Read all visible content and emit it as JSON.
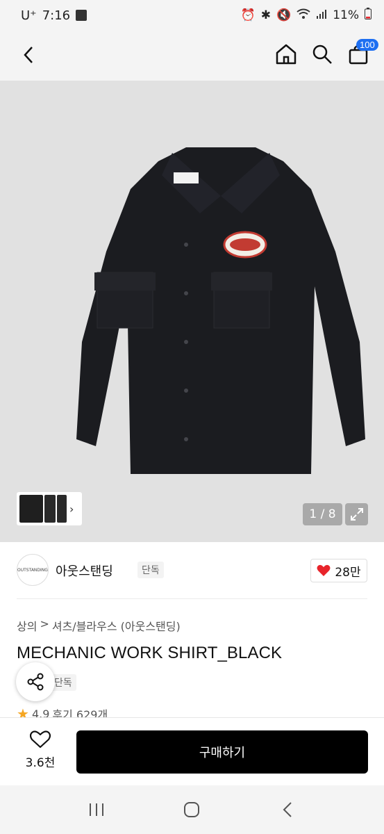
{
  "status_bar": {
    "carrier": "U⁺",
    "time": "7:16",
    "battery": "11%"
  },
  "top_nav": {
    "cart_count": "100"
  },
  "gallery": {
    "page_indicator": "1 / 8"
  },
  "brand": {
    "logo_text": "OUTSTANDING",
    "name": "아웃스탠딩",
    "tag": "단독",
    "likes": "28만"
  },
  "breadcrumb": {
    "category": "상의",
    "separator": ">",
    "subcategory": "셔츠/블라우스 (아웃스탠딩)"
  },
  "product": {
    "title": "MECHANIC WORK SHIRT_BLACK",
    "exclusive_tag": "단독",
    "rating": "4.9",
    "reviews": "후기 629개"
  },
  "action_bar": {
    "wish_count": "3.6천",
    "buy_label": "구매하기"
  },
  "colors": {
    "accent_blue": "#1e6ff1",
    "heart_red": "#e8242b",
    "buy_button": "#000000"
  }
}
